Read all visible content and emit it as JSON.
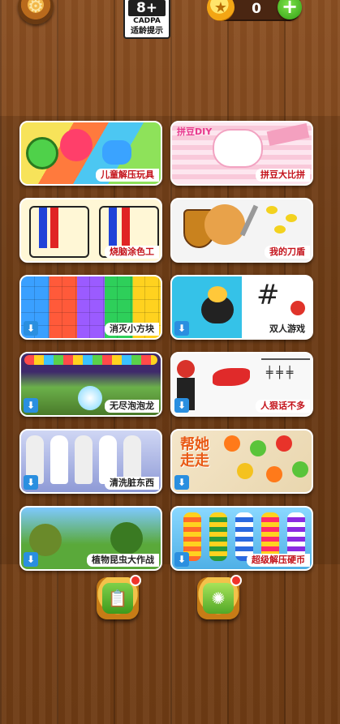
{
  "header": {
    "age_rating": "8+",
    "rating_org": "CADPA",
    "rating_tip": "适龄提示",
    "coin_count": "0",
    "settings_icon": "gear-icon",
    "coin_icon": "star-coin-icon",
    "add_icon": "plus-icon"
  },
  "games": [
    {
      "title": "儿童解压玩具",
      "download": false
    },
    {
      "title": "拼豆大比拼",
      "download": false,
      "badge": "拼豆DIY"
    },
    {
      "title": "烧脑涂色工",
      "download": false
    },
    {
      "title": "我的刀盾",
      "download": false
    },
    {
      "title": "消灭小方块",
      "download": true
    },
    {
      "title": "双人游戏",
      "download": true
    },
    {
      "title": "无尽泡泡龙",
      "download": true
    },
    {
      "title": "人狠话不多",
      "download": true
    },
    {
      "title": "清洗脏东西",
      "download": true
    },
    {
      "title": "",
      "download": true,
      "badge": "帮她走走"
    },
    {
      "title": "植物昆虫大作战",
      "download": true
    },
    {
      "title": "超级解压硬币",
      "download": true
    }
  ],
  "bottom_nav": [
    {
      "icon": "calendar-check-icon",
      "has_badge": true
    },
    {
      "icon": "lime-slice-icon",
      "has_badge": true
    }
  ]
}
